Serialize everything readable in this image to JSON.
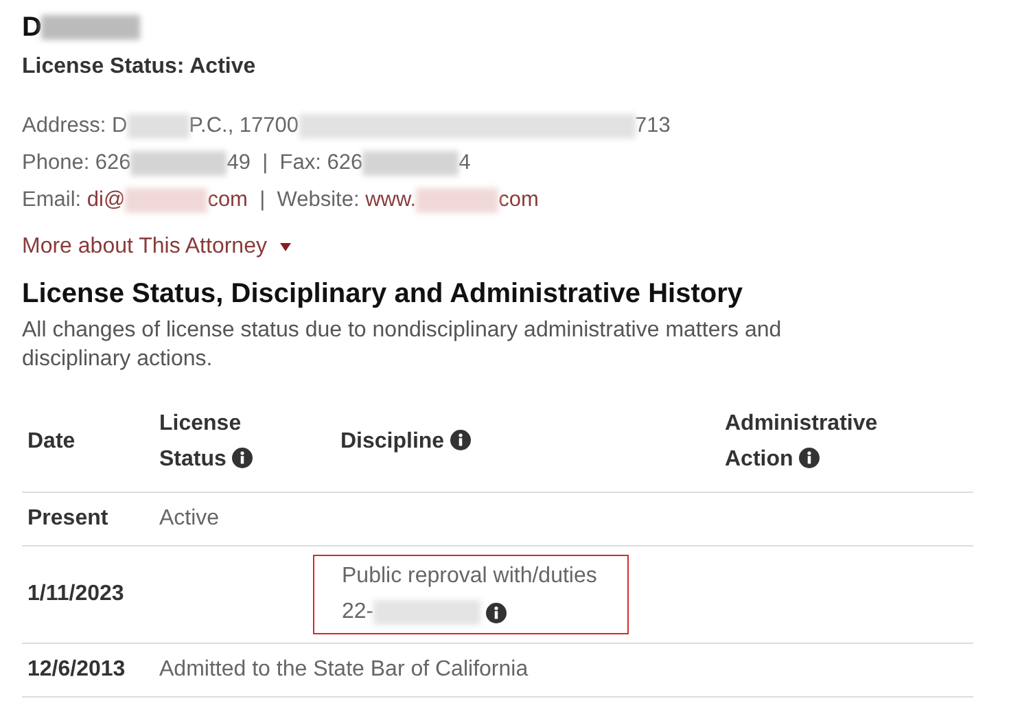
{
  "name": [
    {
      "kind": "text",
      "text": "D"
    },
    {
      "kind": "redacted"
    }
  ],
  "license_status": "License Status: Active",
  "contact_lines": [
    [
      {
        "kind": "text",
        "text": "Address: D"
      },
      {
        "kind": "redacted_short"
      },
      {
        "kind": "text",
        "text": "P.C., 17700"
      },
      {
        "kind": "redacted_long"
      },
      {
        "kind": "text",
        "text": "713"
      }
    ],
    [
      {
        "kind": "text",
        "text": "Phone: 626"
      },
      {
        "kind": "redacted"
      },
      {
        "kind": "text",
        "text": "49  |  Fax: 626"
      },
      {
        "kind": "redacted"
      },
      {
        "kind": "text",
        "text": "4"
      }
    ],
    [
      {
        "kind": "text",
        "text": "Email: "
      },
      {
        "kind": "link",
        "text": "di@"
      },
      {
        "kind": "redacted_link"
      },
      {
        "kind": "link",
        "text": "com"
      },
      {
        "kind": "text",
        "text": "  |  Website: "
      },
      {
        "kind": "link",
        "text": "www."
      },
      {
        "kind": "redacted_link"
      },
      {
        "kind": "link",
        "text": "com"
      }
    ]
  ],
  "more_link": {
    "label": "More about This Attorney",
    "expanded": false
  },
  "history": {
    "title": "License Status, Disciplinary and Administrative History",
    "description": "All changes of license status due to nondisciplinary administrative matters and disciplinary actions.",
    "columns": [
      {
        "label": "Date",
        "info": false
      },
      {
        "label": "License Status",
        "info": true
      },
      {
        "label": "Discipline",
        "info": true
      },
      {
        "label": "Administrative Action",
        "info": true
      }
    ],
    "rows": [
      {
        "kind": "entry",
        "date": "Present",
        "status": "Active",
        "discipline": []
      },
      {
        "kind": "entry",
        "date": "1/11/2023",
        "status": "",
        "discipline": [
          {
            "kind": "text",
            "text": "Public reproval with/duties"
          },
          {
            "kind": "case",
            "text": "22-"
          }
        ],
        "highlighted": true
      },
      {
        "kind": "note",
        "date": "12/6/2013",
        "note": "Admitted to the State Bar of California"
      }
    ]
  }
}
